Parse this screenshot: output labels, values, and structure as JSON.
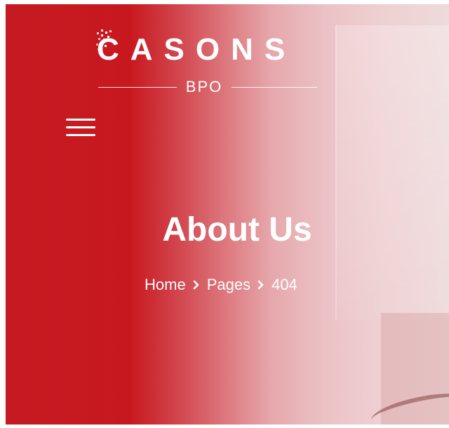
{
  "brand": {
    "name": "CASONS",
    "subtitle": "BPO",
    "logo_icon": "pixel-dots-c-logo"
  },
  "header": {
    "menu_icon": "hamburger-menu-icon"
  },
  "hero": {
    "title": "About Us",
    "breadcrumb": [
      {
        "label": "Home"
      },
      {
        "label": "Pages"
      },
      {
        "label": "404"
      }
    ],
    "separator_icon": "chevron-right-icon"
  },
  "colors": {
    "brand_red": "#c8181f",
    "text": "#ffffff"
  }
}
